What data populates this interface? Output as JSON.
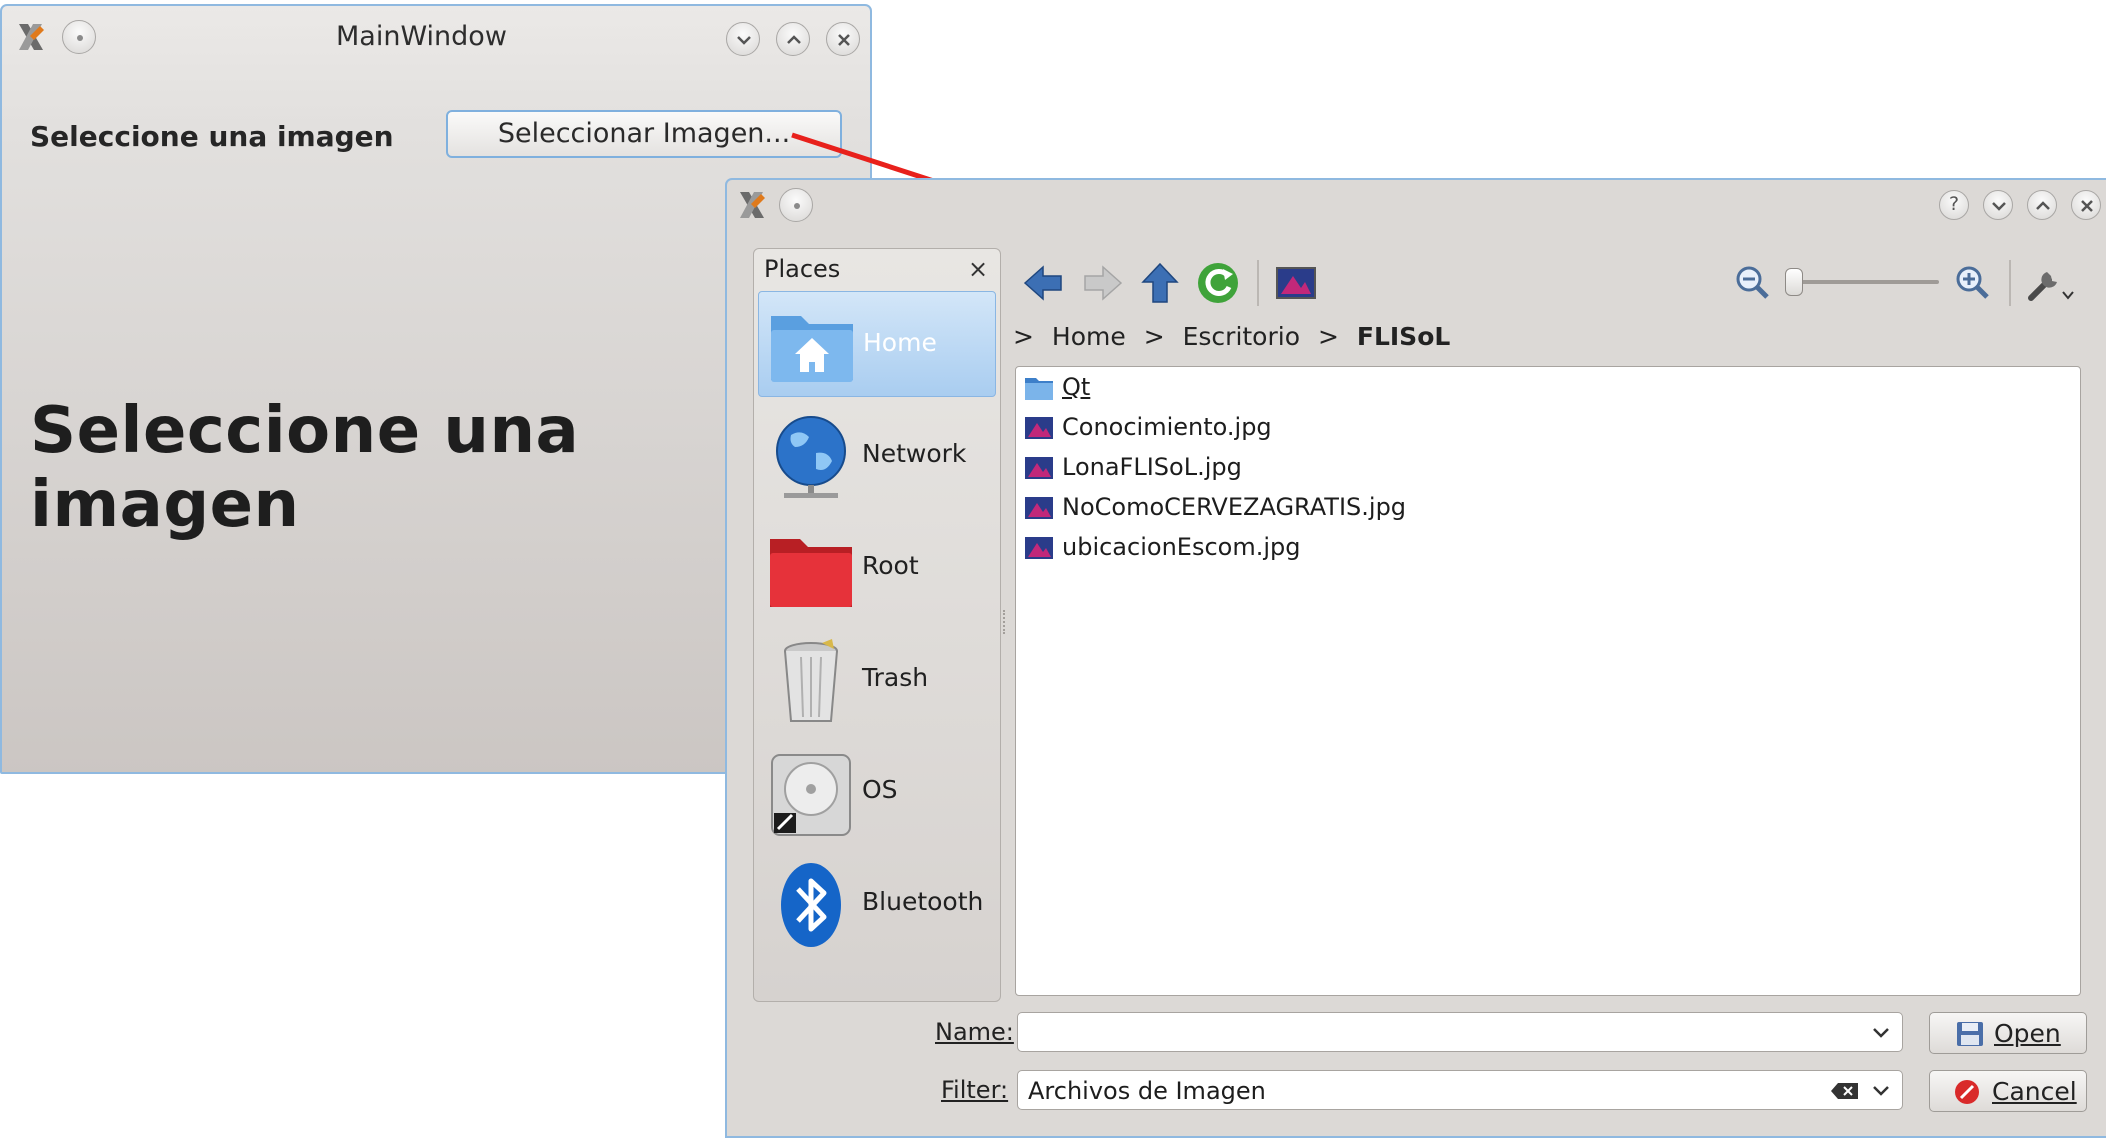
{
  "main_window": {
    "title": "MainWindow",
    "prompt_label": "Seleccione una imagen",
    "select_button": "Seleccionar Imagen...",
    "image_label": "Seleccione una imagen"
  },
  "dialog": {
    "places": {
      "header": "Places",
      "close_glyph": "×",
      "items": [
        {
          "label": "Home",
          "icon": "home-folder-icon",
          "selected": true
        },
        {
          "label": "Network",
          "icon": "network-globe-icon"
        },
        {
          "label": "Root",
          "icon": "red-folder-icon"
        },
        {
          "label": "Trash",
          "icon": "trash-icon"
        },
        {
          "label": "OS",
          "icon": "hard-drive-icon"
        },
        {
          "label": "Bluetooth",
          "icon": "bluetooth-icon"
        }
      ]
    },
    "breadcrumb": {
      "sep": ">",
      "items": [
        "Home",
        "Escritorio",
        "FLISoL"
      ]
    },
    "files": [
      {
        "name": "Qt",
        "type": "folder"
      },
      {
        "name": "Conocimiento.jpg",
        "type": "image"
      },
      {
        "name": "LonaFLISoL.jpg",
        "type": "image"
      },
      {
        "name": "NoComoCERVEZAGRATIS.jpg",
        "type": "image"
      },
      {
        "name": "ubicacionEscom.jpg",
        "type": "image"
      }
    ],
    "name_label": "Name:",
    "name_value": "",
    "filter_label": "Filter:",
    "filter_value": "Archivos de Imagen",
    "open_button": "Open",
    "cancel_button": "Cancel",
    "help_glyph": "?"
  },
  "colors": {
    "accent_blue": "#8fb9e0",
    "selection": "#a9cdf0",
    "arrow_red": "#e8211c"
  }
}
